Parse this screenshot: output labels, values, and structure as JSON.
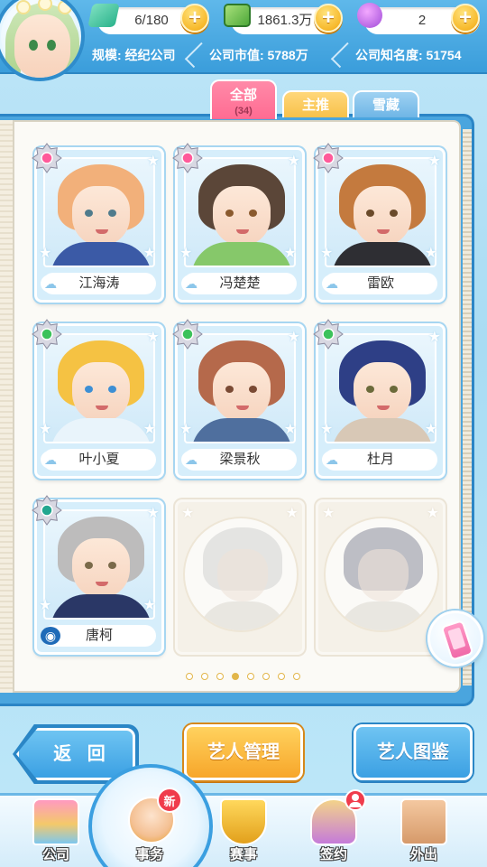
{
  "header": {
    "energy": "6/180",
    "money": "1861.3万",
    "gems": "2",
    "plus": "+",
    "scale_label": "规模: 经纪公司",
    "market_value_label": "公司市值: 5788万",
    "fame_label": "公司知名度: 51754"
  },
  "tabs": {
    "all_label": "全部",
    "all_count": "(34)",
    "main_label": "主推",
    "hidden_label": "雪藏"
  },
  "cards": [
    {
      "name": "江海涛",
      "rank": "pink",
      "hair": "#f2b07a",
      "eye": "#4f7b8c",
      "body": "#3b5aa6"
    },
    {
      "name": "冯楚楚",
      "rank": "pink",
      "hair": "#5b4638",
      "eye": "#8a5a2e",
      "body": "#86c86a"
    },
    {
      "name": "雷欧",
      "rank": "pink",
      "hair": "#c47a3e",
      "eye": "#6a4a2a",
      "body": "#2e2e33"
    },
    {
      "name": "叶小夏",
      "rank": "green",
      "hair": "#f5c243",
      "eye": "#3d8fd4",
      "body": "#e9f4fb"
    },
    {
      "name": "梁景秋",
      "rank": "green",
      "hair": "#b5694b",
      "eye": "#7a4a34",
      "body": "#4f6f9e"
    },
    {
      "name": "杜月",
      "rank": "green",
      "hair": "#2e3f86",
      "eye": "#6b6a3a",
      "body": "#d8c8b6"
    },
    {
      "name": "唐柯",
      "rank": "teal",
      "hair": "#bdbcbc",
      "eye": "#7a6a4a",
      "body": "#2a3766"
    }
  ],
  "ghost_cards": [
    {
      "hair": "#b9b9b9"
    },
    {
      "hair": "#4a4e66"
    }
  ],
  "pagination": {
    "total": 8,
    "active": 3
  },
  "buttons": {
    "back": "返 回",
    "manage": "艺人管理",
    "catalog": "艺人图鉴"
  },
  "nav": {
    "company": "公司",
    "affairs": "事务",
    "events": "赛事",
    "sign": "签约",
    "outing": "外出",
    "new_badge": "新"
  },
  "colors": {
    "accent_blue": "#3ba0e3",
    "accent_orange": "#f7a62a",
    "tab_pink": "#ff6b92"
  }
}
